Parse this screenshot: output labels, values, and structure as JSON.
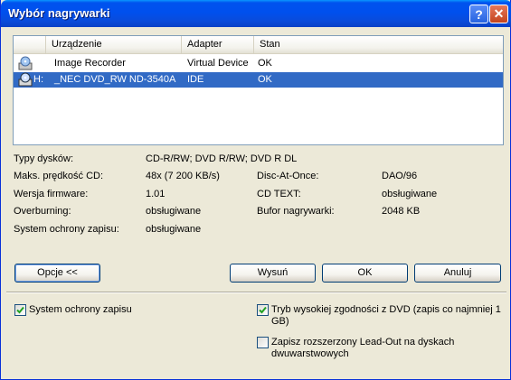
{
  "window": {
    "title": "Wybór nagrywarki"
  },
  "titlebar": {
    "help_glyph": "?",
    "close_glyph": "✕"
  },
  "list": {
    "columns": [
      "Urządzenie",
      "Adapter",
      "Stan"
    ],
    "rows": [
      {
        "letter": "",
        "device": "Image Recorder",
        "adapter": "Virtual Device",
        "status": "OK",
        "selected": false,
        "icon": "disc-recorder-icon"
      },
      {
        "letter": "H:",
        "device": "_NEC DVD_RW ND-3540A",
        "adapter": "IDE",
        "status": "OK",
        "selected": true,
        "icon": "dvd-drive-icon"
      }
    ]
  },
  "info": {
    "disc_types_label": "Typy dysków:",
    "disc_types_value": "CD-R/RW; DVD R/RW; DVD R DL",
    "max_speed_label": "Maks. prędkość CD:",
    "max_speed_value": "48x (7 200 KB/s)",
    "dao_label": "Disc-At-Once:",
    "dao_value": "DAO/96",
    "firmware_label": "Wersja firmware:",
    "firmware_value": "1.01",
    "cdtext_label": "CD TEXT:",
    "cdtext_value": "obsługiwane",
    "overburning_label": "Overburning:",
    "overburning_value": "obsługiwane",
    "buffer_label": "Bufor nagrywarki:",
    "buffer_value": "2048 KB",
    "protection_label": "System ochrony zapisu:",
    "protection_value": "obsługiwane"
  },
  "buttons": {
    "options": "Opcje <<",
    "eject": "Wysuń",
    "ok": "OK",
    "cancel": "Anuluj"
  },
  "options": {
    "protection_checkbox": {
      "label": "System ochrony zapisu",
      "checked": true
    },
    "compat_checkbox_line1": "Tryb wysokiej zgodności z DVD (zapis co najmniej 1",
    "compat_checkbox_line2": "GB)",
    "compat_checked": true,
    "leadout_checkbox_line1": "Zapisz rozszerzony Lead-Out na dyskach",
    "leadout_checkbox_line2": "dwuwarstwowych",
    "leadout_checked": false
  },
  "colors": {
    "selection": "#316ac5",
    "title_bar": "#0053ee",
    "dialog_bg": "#ece9d8"
  }
}
